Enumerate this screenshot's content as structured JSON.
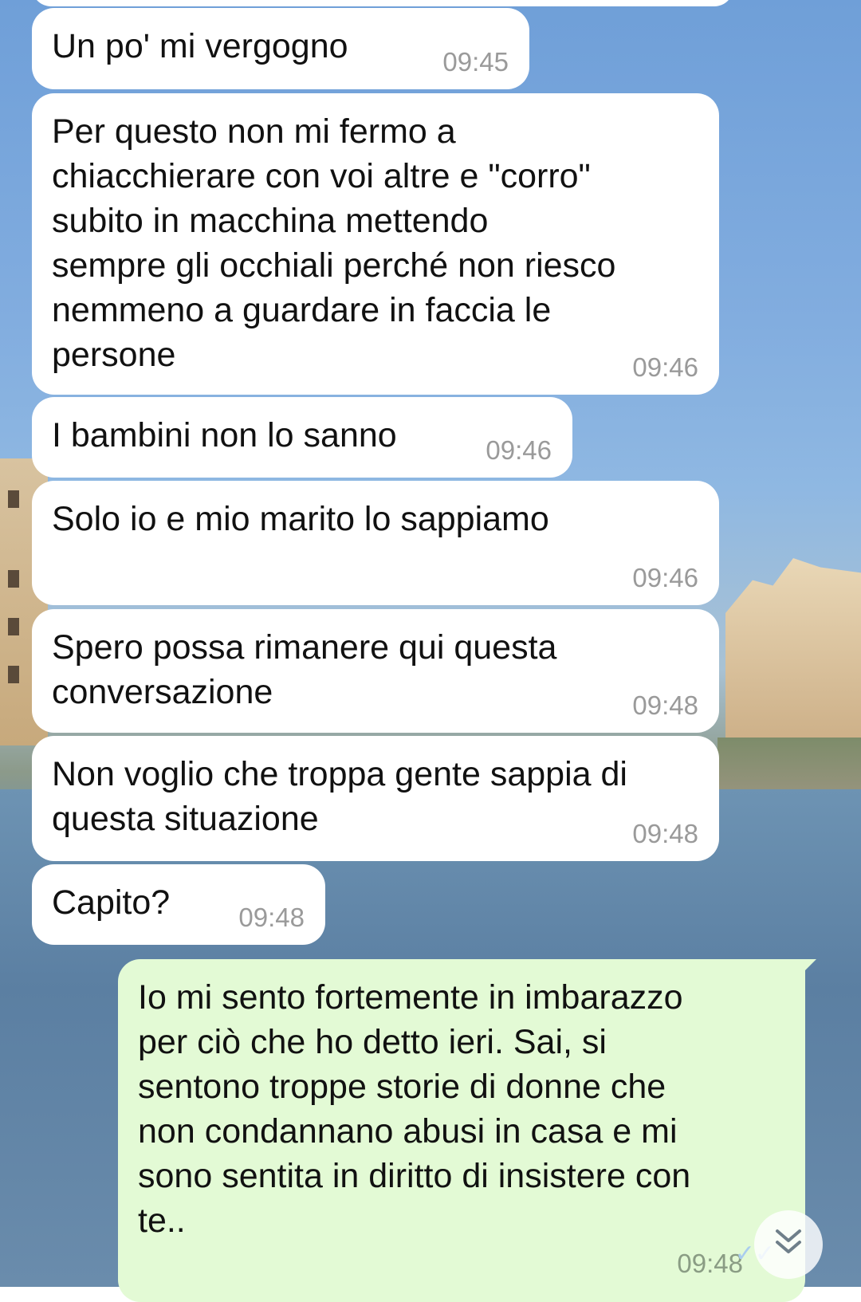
{
  "messages": [
    {
      "text": "Un po' mi vergogno",
      "time": "09:45"
    },
    {
      "text": "Per questo non mi fermo a\nchiacchierare con voi altre e \"corro\"\nsubito in macchina mettendo\nsempre gli occhiali perché non riesco\nnemmeno a guardare in faccia le\npersone",
      "time": "09:46"
    },
    {
      "text": "I bambini non lo sanno",
      "time": "09:46"
    },
    {
      "text": "Solo io e mio marito lo sappiamo",
      "time": "09:46"
    },
    {
      "text": "Spero possa rimanere qui questa\nconversazione",
      "time": "09:48"
    },
    {
      "text": "Non voglio che troppa gente sappia di\nquesta situazione",
      "time": "09:48"
    },
    {
      "text": "Capito?",
      "time": "09:48"
    },
    {
      "text": "Io mi sento fortemente in imbarazzo\nper ciò che ho detto ieri. Sai, si\nsentono troppe storie di donne che\nnon condannano abusi in casa e mi\nsono sentita in diritto di insistere con\nte..",
      "time": "09:48"
    }
  ],
  "icons": {
    "read_receipt": "double-check-icon",
    "scroll_down": "chevron-double-down-icon"
  },
  "colors": {
    "incoming_bubble": "#ffffff",
    "outgoing_bubble": "#e3fad5",
    "timestamp": "#9a9a9a"
  }
}
